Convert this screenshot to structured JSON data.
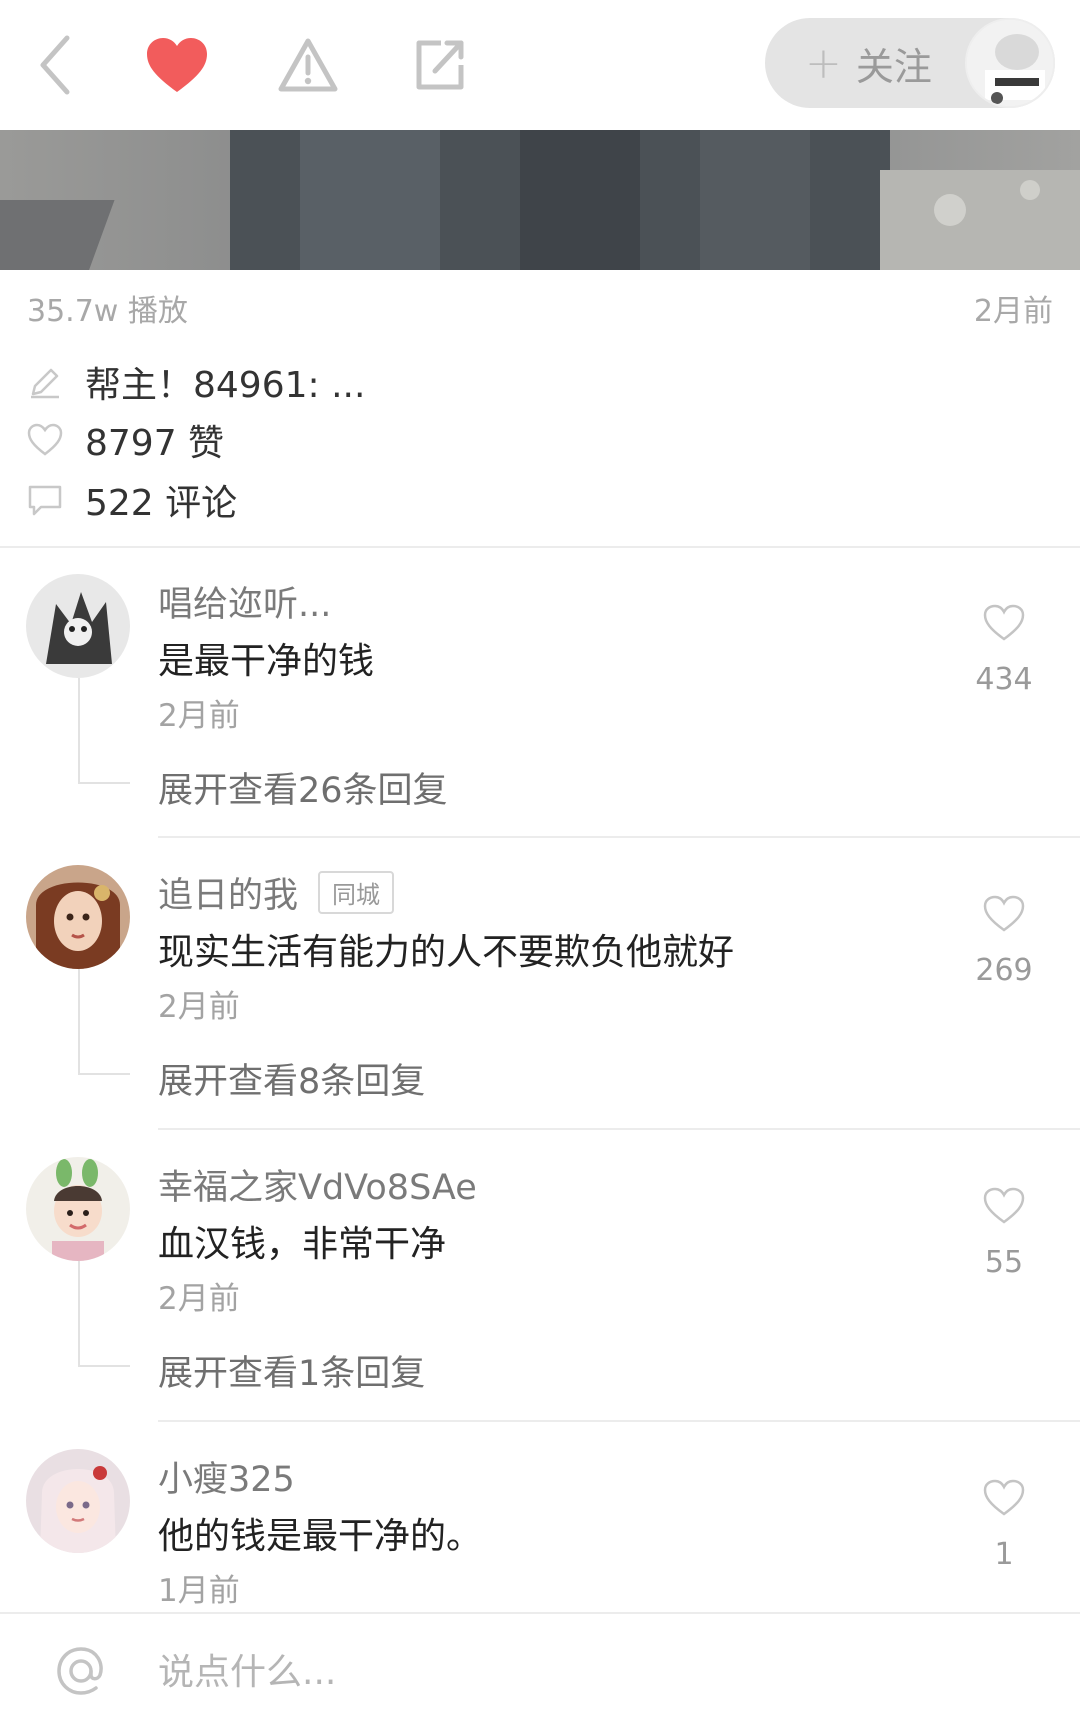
{
  "header": {
    "follow_label": "关注"
  },
  "video": {
    "plays": "35.7w 播放",
    "posted": "2月前"
  },
  "post": {
    "caption": "帮主！84961: ...",
    "likes": "8797 赞",
    "comments": "522 评论"
  },
  "comments": [
    {
      "name": "唱给迩听...",
      "tag": "",
      "text": "是最干净的钱",
      "time": "2月前",
      "likes": "434",
      "expand": "展开查看26条回复"
    },
    {
      "name": "追日的我",
      "tag": "同城",
      "text": "现实生活有能力的人不要欺负他就好",
      "time": "2月前",
      "likes": "269",
      "expand": "展开查看8条回复"
    },
    {
      "name": "幸福之家VdVo8SAe",
      "tag": "",
      "text": "血汉钱，非常干净",
      "time": "2月前",
      "likes": "55",
      "expand": "展开查看1条回复"
    },
    {
      "name": "小瘦325",
      "tag": "",
      "text": "他的钱是最干净的。",
      "time": "1月前",
      "likes": "1",
      "expand": ""
    }
  ],
  "input": {
    "placeholder": "说点什么..."
  },
  "colors": {
    "liked_heart": "#f25c5c",
    "icon_gray": "#c4c4c4",
    "text_gray": "#a3a3a3"
  },
  "icons": [
    "back-arrow-icon",
    "heart-icon",
    "warning-icon",
    "share-icon",
    "pencil-icon",
    "heart-outline-icon",
    "comment-icon",
    "at-icon"
  ]
}
